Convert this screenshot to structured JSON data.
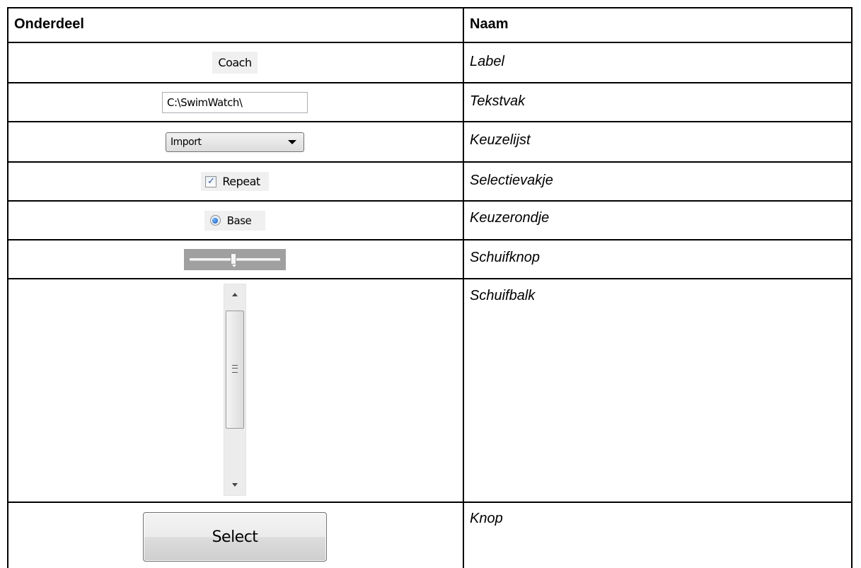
{
  "table": {
    "headers": {
      "part": "Onderdeel",
      "name": "Naam"
    },
    "rows": [
      {
        "control": "label",
        "sample": "Coach",
        "name": "Label"
      },
      {
        "control": "textbox",
        "sample": "C:\\SwimWatch\\",
        "name": "Tekstvak"
      },
      {
        "control": "combobox",
        "sample": "Import",
        "name": "Keuzelijst"
      },
      {
        "control": "checkbox",
        "sample": "Repeat",
        "checked": true,
        "name": "Selectievakje"
      },
      {
        "control": "radio",
        "sample": "Base",
        "selected": true,
        "name": "Keuzerondje"
      },
      {
        "control": "slider",
        "sample": "",
        "value": 0.5,
        "name": "Schuifknop"
      },
      {
        "control": "scrollbar",
        "sample": "",
        "name": "Schuifbalk"
      },
      {
        "control": "button",
        "sample": "Select",
        "name": "Knop"
      }
    ]
  },
  "icons": {
    "checkmark": "checkmark-icon",
    "combo_arrow": "chevron-down-icon",
    "scroll_up": "arrow-up-icon",
    "scroll_down": "arrow-down-icon",
    "grip": "grip-icon"
  }
}
